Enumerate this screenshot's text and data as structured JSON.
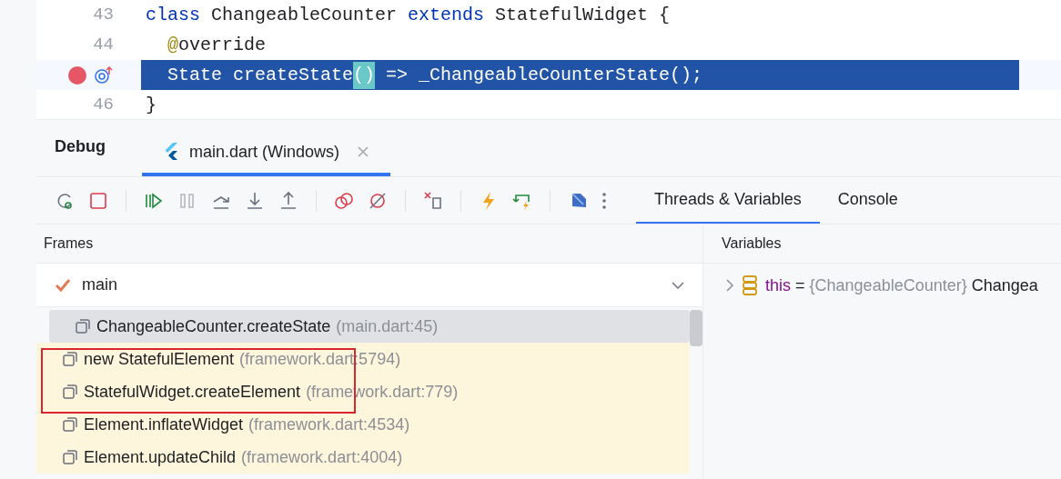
{
  "code_lines": [
    {
      "number": "43",
      "breakpoint": false,
      "current": false,
      "segments": [
        {
          "text": "class ",
          "kind": "keyword"
        },
        {
          "text": "ChangeableCounter",
          "kind": "plain"
        },
        {
          "text": " extends ",
          "kind": "keyword"
        },
        {
          "text": "StatefulWidget {",
          "kind": "plain"
        }
      ]
    },
    {
      "number": "44",
      "breakpoint": false,
      "current": false,
      "segments": [
        {
          "text": "  @",
          "kind": "annotation"
        },
        {
          "text": "override",
          "kind": "plain"
        }
      ]
    },
    {
      "breakpoint": true,
      "current": true,
      "segments": [
        {
          "text": "  State createState",
          "kind": "plain"
        },
        {
          "text": "()",
          "kind": "match"
        },
        {
          "text": " => _ChangeableCounterState();",
          "kind": "plain"
        }
      ]
    },
    {
      "number": "46",
      "breakpoint": false,
      "current": false,
      "segments": [
        {
          "text": "}",
          "kind": "plain"
        }
      ]
    }
  ],
  "debug": {
    "title": "Debug",
    "session_tabs": [
      {
        "label": "main.dart (Windows)",
        "selected": true
      }
    ]
  },
  "view_tabs": [
    {
      "label": "Threads & Variables",
      "selected": true
    },
    {
      "label": "Console",
      "selected": false
    }
  ],
  "frames": {
    "title": "Frames",
    "thread": "main",
    "items": [
      {
        "name": "ChangeableCounter.createState",
        "location": "(main.dart:45)",
        "selected": true,
        "library": false
      },
      {
        "name": "new StatefulElement",
        "location": "(framework.dart:5794)",
        "selected": false,
        "library": true
      },
      {
        "name": "StatefulWidget.createElement",
        "location": "(framework.dart:779)",
        "selected": false,
        "library": true
      },
      {
        "name": "Element.inflateWidget",
        "location": "(framework.dart:4534)",
        "selected": false,
        "library": true
      },
      {
        "name": "Element.updateChild",
        "location": "(framework.dart:4004)",
        "selected": false,
        "library": true
      }
    ]
  },
  "variables": {
    "title": "Variables",
    "items": [
      {
        "name": "this",
        "operator": "=",
        "type": "{ChangeableCounter}",
        "value": "Changea",
        "expanded": false
      }
    ]
  }
}
